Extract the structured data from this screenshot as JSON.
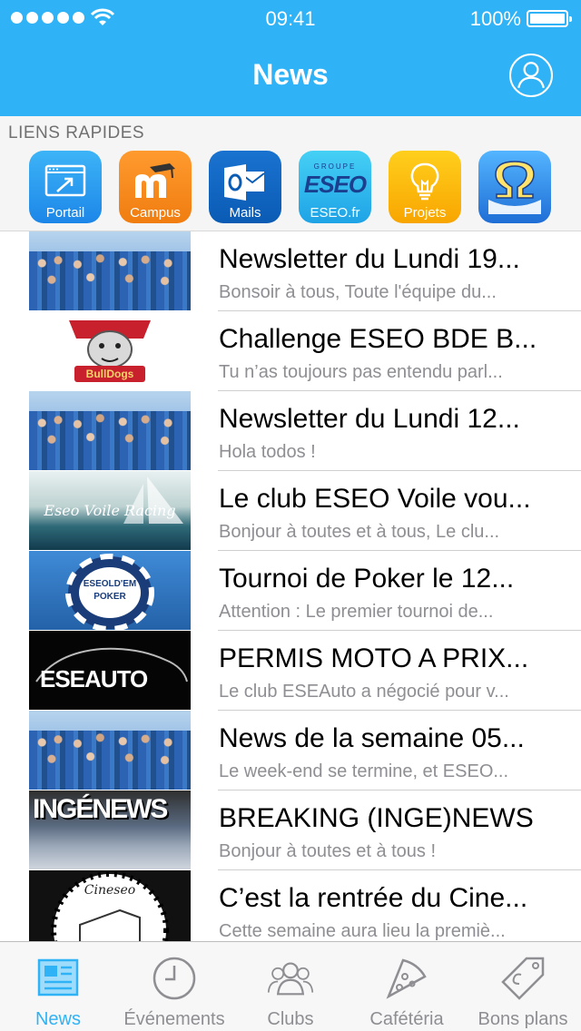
{
  "status_bar": {
    "time": "09:41",
    "battery": "100%"
  },
  "header": {
    "title": "News"
  },
  "quick_links": {
    "title": "LIENS RAPIDES",
    "items": [
      {
        "label": "Portail",
        "icon": "portal-icon"
      },
      {
        "label": "Campus",
        "icon": "moodle-icon"
      },
      {
        "label": "Mails",
        "icon": "outlook-icon"
      },
      {
        "label": "ESEO.fr",
        "icon": "eseo-logo-icon",
        "logo_text": "ESEO",
        "logo_small": "GROUPE"
      },
      {
        "label": "Projets",
        "icon": "lightbulb-icon"
      },
      {
        "label": "",
        "icon": "omega-icon"
      }
    ]
  },
  "news": [
    {
      "title": "Newsletter du Lundi 19...",
      "excerpt": "Bonsoir à tous, Toute l'équipe du..."
    },
    {
      "title": "Challenge ESEO BDE B...",
      "excerpt": "Tu n’as toujours pas entendu parl...",
      "logo_text": "BullDogs"
    },
    {
      "title": "Newsletter du Lundi 12...",
      "excerpt": "Hola todos !"
    },
    {
      "title": "Le club ESEO Voile vou...",
      "excerpt": "Bonjour à toutes et à tous, Le clu...",
      "logo_text": "Eseo Voile Racing"
    },
    {
      "title": "Tournoi de Poker le 12...",
      "excerpt": "Attention : Le premier tournoi de...",
      "logo_text": "ESEOLD'EM POKER"
    },
    {
      "title": "PERMIS MOTO A PRIX...",
      "excerpt": "Le club ESEAuto a négocié pour v...",
      "logo_text": "ESEAUTO"
    },
    {
      "title": "News de la semaine 05...",
      "excerpt": "Le week-end se termine, et ESEO..."
    },
    {
      "title": "BREAKING (INGE)NEWS",
      "excerpt": "Bonjour à toutes et à tous !",
      "logo_text": "INGÉNEWS"
    },
    {
      "title": "C’est la rentrée du Cine...",
      "excerpt": "Cette semaine aura lieu la premiè...",
      "logo_text": "Cineseo"
    }
  ],
  "tabs": [
    {
      "label": "News",
      "icon": "newspaper-icon",
      "active": true
    },
    {
      "label": "Événements",
      "icon": "clock-icon",
      "active": false
    },
    {
      "label": "Clubs",
      "icon": "people-icon",
      "active": false
    },
    {
      "label": "Cafétéria",
      "icon": "pizza-icon",
      "active": false
    },
    {
      "label": "Bons plans",
      "icon": "price-tag-icon",
      "active": false
    }
  ],
  "colors": {
    "accent": "#2fb3f6",
    "tab_inactive": "#8e8e93",
    "subtitle": "#8e8e93"
  }
}
